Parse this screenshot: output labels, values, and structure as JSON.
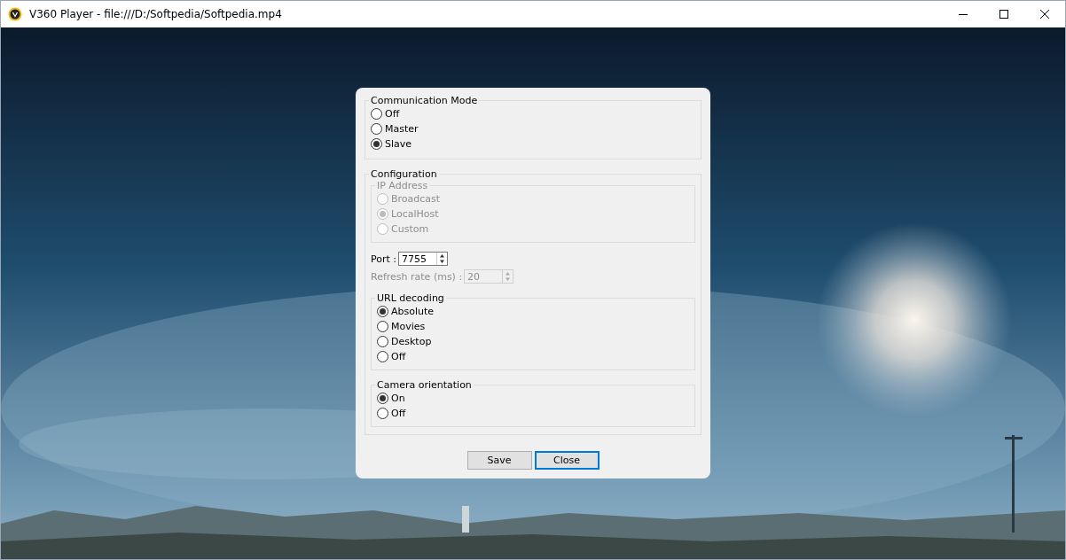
{
  "window": {
    "title": "V360 Player - file:///D:/Softpedia/Softpedia.mp4"
  },
  "dialog": {
    "communication_mode": {
      "label": "Communication Mode",
      "disabled": false,
      "options": [
        {
          "label": "Off",
          "selected": false
        },
        {
          "label": "Master",
          "selected": false
        },
        {
          "label": "Slave",
          "selected": true
        }
      ]
    },
    "configuration": {
      "label": "Configuration",
      "ip_address": {
        "label": "IP Address",
        "disabled": true,
        "options": [
          {
            "label": "Broadcast",
            "selected": false
          },
          {
            "label": "LocalHost",
            "selected": true
          },
          {
            "label": "Custom",
            "selected": false
          }
        ]
      },
      "port": {
        "label": "Port :",
        "value": "7755",
        "disabled": false
      },
      "refresh_rate": {
        "label": "Refresh rate (ms) :",
        "value": "20",
        "disabled": true
      },
      "url_decoding": {
        "label": "URL decoding",
        "disabled": false,
        "options": [
          {
            "label": "Absolute",
            "selected": true
          },
          {
            "label": "Movies",
            "selected": false
          },
          {
            "label": "Desktop",
            "selected": false
          },
          {
            "label": "Off",
            "selected": false
          }
        ]
      },
      "camera_orientation": {
        "label": "Camera orientation",
        "disabled": false,
        "options": [
          {
            "label": "On",
            "selected": true
          },
          {
            "label": "Off",
            "selected": false
          }
        ]
      }
    },
    "buttons": [
      {
        "label": "Save",
        "focused": false
      },
      {
        "label": "Close",
        "focused": true
      }
    ]
  }
}
